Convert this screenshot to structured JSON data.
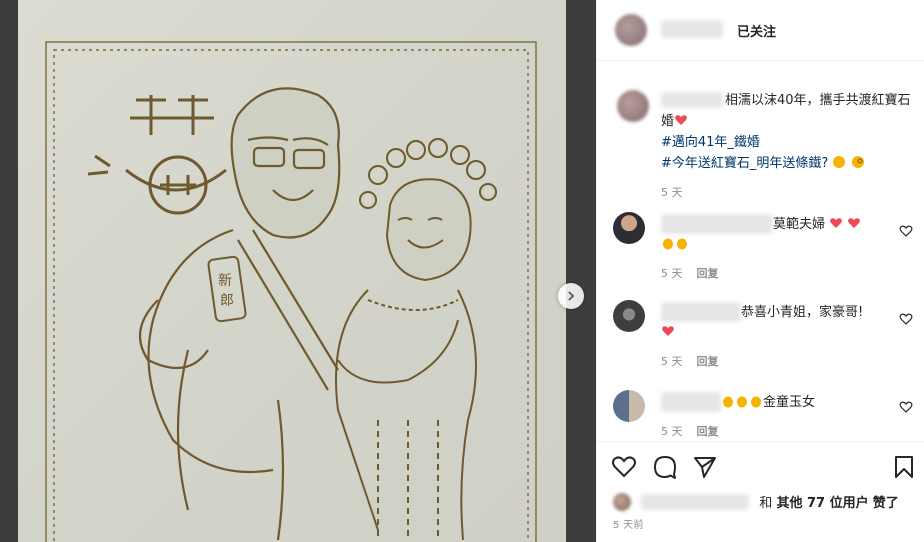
{
  "header": {
    "follow_status": "已关注"
  },
  "caption": {
    "text": "相濡以沫40年，攜手共渡紅寶石婚",
    "hashtags": [
      "#邁向41年_鐵婚",
      "#今年送紅寶石_明年送條鐵?"
    ],
    "time": "5 天"
  },
  "comments": [
    {
      "text": "莫範夫婦",
      "time": "5 天",
      "reply": "回复"
    },
    {
      "text": "恭喜小青姐，家豪哥!",
      "time": "5 天",
      "reply": "回复"
    },
    {
      "text": "金童玉女",
      "time": "5 天",
      "reply": "回复"
    }
  ],
  "actions": {
    "likes_prefix": "和",
    "likes_others": "其他 77 位用户",
    "likes_suffix": "赞了",
    "post_time": "5 天前"
  },
  "artwork": {
    "badge_text": "新郎",
    "double_happiness": "囍"
  },
  "colors": {
    "link": "#00376b",
    "heart": "#ed4956",
    "clap": "#f4b400",
    "engrave": "#6e5a2e"
  },
  "icons": [
    "chevron-right-icon",
    "heart-icon",
    "comment-icon",
    "share-icon",
    "bookmark-icon",
    "small-heart-icon",
    "clapping-hands-emoji"
  ]
}
